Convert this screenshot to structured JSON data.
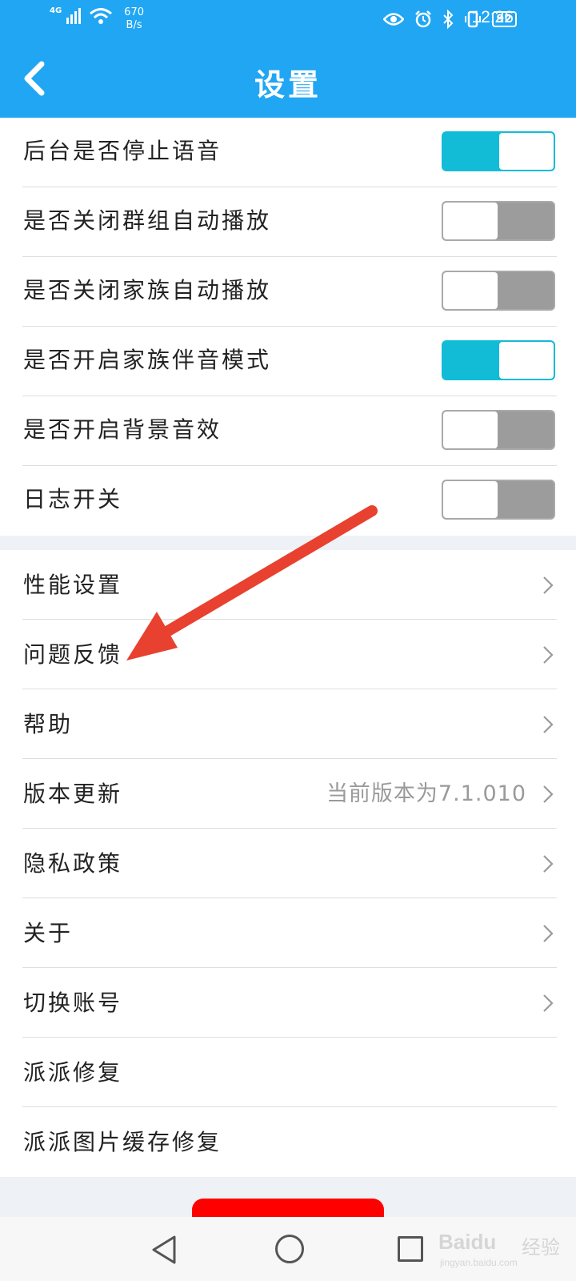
{
  "status_bar": {
    "network": "4G",
    "speed_value": "670",
    "speed_unit": "B/s",
    "battery": "92",
    "time": "12:26"
  },
  "header": {
    "title": "设置",
    "back_icon": "chevron-left-icon"
  },
  "toggles": [
    {
      "label": "后台是否停止语音",
      "on": true
    },
    {
      "label": "是否关闭群组自动播放",
      "on": false
    },
    {
      "label": "是否关闭家族自动播放",
      "on": false
    },
    {
      "label": "是否开启家族伴音模式",
      "on": true
    },
    {
      "label": "是否开启背景音效",
      "on": false
    },
    {
      "label": "日志开关",
      "on": false
    }
  ],
  "menu": [
    {
      "label": "性能设置",
      "value": "",
      "chevron": true
    },
    {
      "label": "问题反馈",
      "value": "",
      "chevron": true
    },
    {
      "label": "帮助",
      "value": "",
      "chevron": true
    },
    {
      "label": "版本更新",
      "value": "当前版本为7.1.010",
      "chevron": true
    },
    {
      "label": "隐私政策",
      "value": "",
      "chevron": true
    },
    {
      "label": "关于",
      "value": "",
      "chevron": true
    },
    {
      "label": "切换账号",
      "value": "",
      "chevron": true
    },
    {
      "label": "派派修复",
      "value": "",
      "chevron": false
    },
    {
      "label": "派派图片缓存修复",
      "value": "",
      "chevron": false
    }
  ],
  "watermark": {
    "brand": "Baidu",
    "jingyan": "经验",
    "url": "jingyan.baidu.com"
  },
  "colors": {
    "accent": "#21a6f3",
    "toggle_on": "#12bcd6",
    "toggle_off": "#9c9c9c",
    "logout": "#ff0000",
    "annotation_arrow": "#e8412f"
  }
}
